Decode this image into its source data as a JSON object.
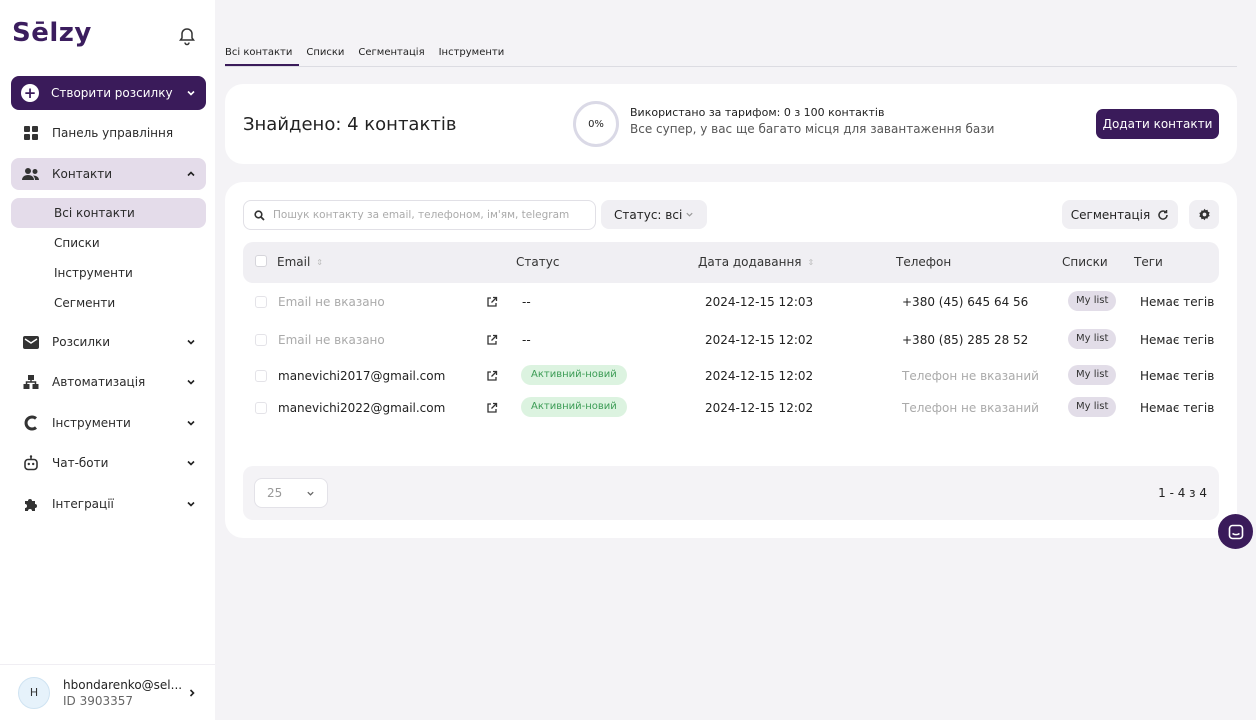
{
  "brand": {
    "logo": "Sēlzy",
    "accent": "#3a1b5a"
  },
  "sidebar": {
    "create_label": "Створити розсилку",
    "items": [
      {
        "label": "Панель управління",
        "icon": "grid-icon"
      },
      {
        "label": "Контакти",
        "icon": "users-icon",
        "expanded": true
      },
      {
        "label": "Розсилки",
        "icon": "mail-icon"
      },
      {
        "label": "Автоматизація",
        "icon": "automation-icon"
      },
      {
        "label": "Інструменти",
        "icon": "tools-icon"
      },
      {
        "label": "Чат-боти",
        "icon": "bot-icon"
      },
      {
        "label": "Інтеграції",
        "icon": "puzzle-icon"
      }
    ],
    "contacts_sub": [
      "Всі контакти",
      "Списки",
      "Інструменти",
      "Сегменти"
    ]
  },
  "user": {
    "initial": "H",
    "email": "hbondarenko@sel...",
    "id": "ID 3903357"
  },
  "tabs": [
    "Всі контакти",
    "Списки",
    "Сегментація",
    "Інструменти"
  ],
  "summary": {
    "found": "Знайдено: 4 контактів",
    "percent": "0%",
    "usage_line1": "Використано за тарифом: 0 з 100 контактів",
    "usage_line2": "Все супер, у вас ще багато місця для завантаження бази",
    "add_button": "Додати контакти"
  },
  "toolbar": {
    "search_placeholder": "Пошук контакту за email, телефоном, ім'ям, telegram",
    "status_filter": "Статус: всі",
    "segmentation": "Сегментація"
  },
  "table": {
    "columns": [
      "Email",
      "Статус",
      "Дата додавання",
      "Телефон",
      "Списки",
      "Теги"
    ],
    "rows": [
      {
        "email": "Email не вказано",
        "status": "--",
        "date": "2024-12-15 12:03",
        "phone": "+380 (45) 645 64 56",
        "list": "My list",
        "tags": "Немає тегів"
      },
      {
        "email": "Email не вказано",
        "status": "--",
        "date": "2024-12-15 12:02",
        "phone": "+380 (85) 285 28 52",
        "list": "My list",
        "tags": "Немає тегів"
      },
      {
        "email": "manevichi2017@gmail.com",
        "status": "Активний-новий",
        "date": "2024-12-15 12:02",
        "phone": "Телефон не вказаний",
        "list": "My list",
        "tags": "Немає тегів"
      },
      {
        "email": "manevichi2022@gmail.com",
        "status": "Активний-новий",
        "date": "2024-12-15 12:02",
        "phone": "Телефон не вказаний",
        "list": "My list",
        "tags": "Немає тегів"
      }
    ]
  },
  "pagination": {
    "per_page": "25",
    "range": "1 - 4 з 4"
  }
}
